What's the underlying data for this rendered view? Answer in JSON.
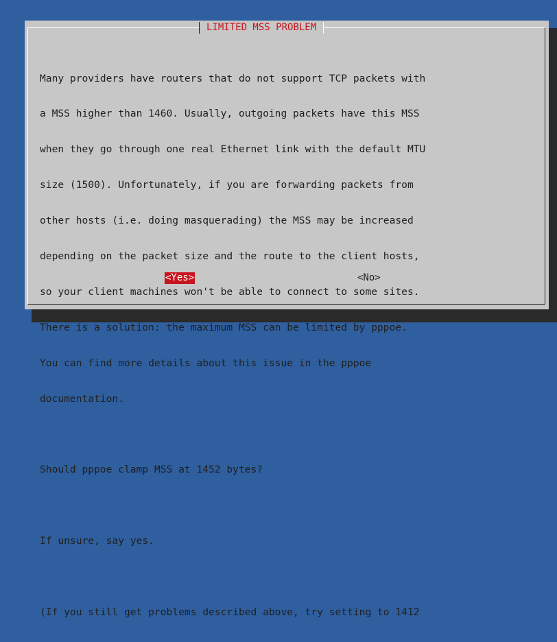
{
  "dialog": {
    "title": "LIMITED MSS PROBLEM",
    "lines": [
      "Many providers have routers that do not support TCP packets with",
      "a MSS higher than 1460. Usually, outgoing packets have this MSS",
      "when they go through one real Ethernet link with the default MTU",
      "size (1500). Unfortunately, if you are forwarding packets from",
      "other hosts (i.e. doing masquerading) the MSS may be increased",
      "depending on the packet size and the route to the client hosts,",
      "so your client machines won't be able to connect to some sites.",
      "There is a solution: the maximum MSS can be limited by pppoe.",
      "You can find more details about this issue in the pppoe",
      "documentation.",
      "",
      "Should pppoe clamp MSS at 1452 bytes?",
      "",
      "If unsure, say yes.",
      "",
      "(If you still get problems described above, try setting to 1412"
    ],
    "buttons": {
      "yes": "<Yes>",
      "no": "<No>"
    }
  },
  "colors": {
    "background": "#2f5f9e",
    "dialog": "#c7c7c7",
    "accent": "#c8141e",
    "shadow": "#2a2a2a"
  }
}
